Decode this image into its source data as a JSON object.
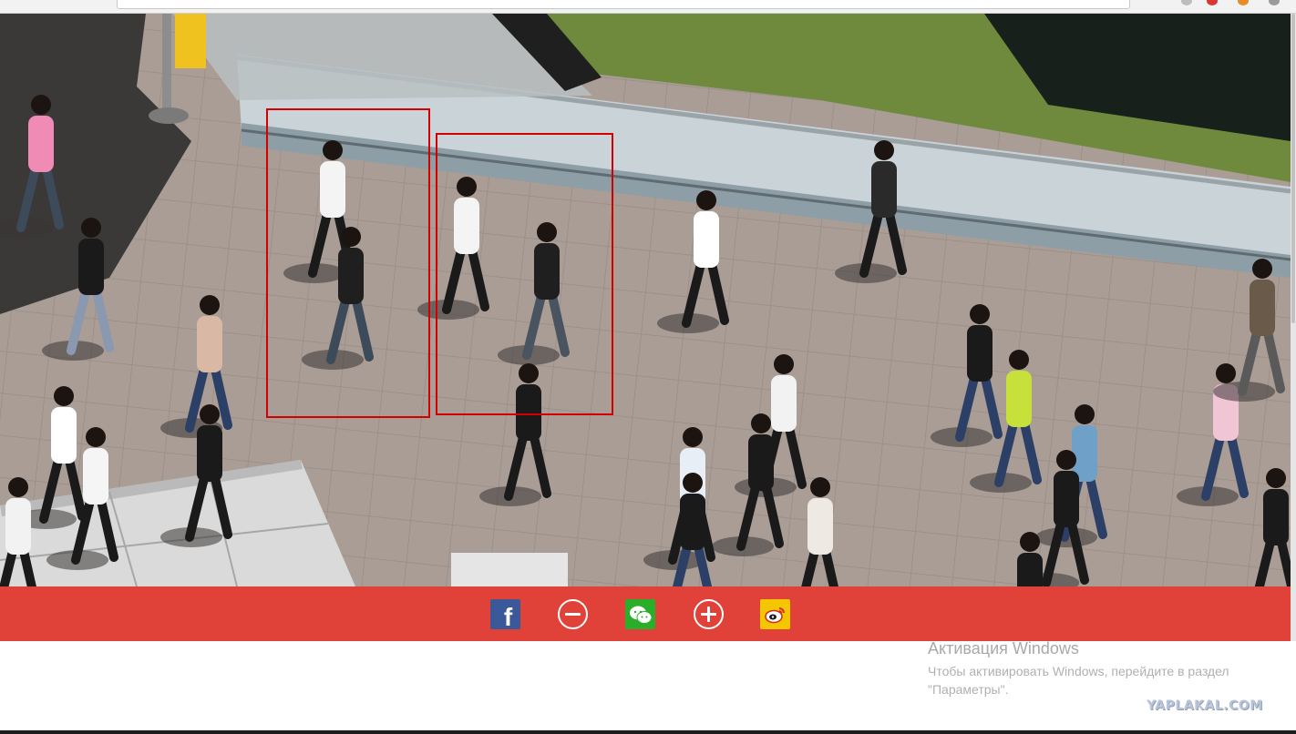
{
  "share_bar": {
    "buttons": [
      {
        "name": "facebook",
        "glyph": "f",
        "color": "#3b5998"
      },
      {
        "name": "zoom-out",
        "color": "#ffffff"
      },
      {
        "name": "wechat",
        "color": "#2aae2a"
      },
      {
        "name": "zoom-in",
        "color": "#ffffff"
      },
      {
        "name": "weibo",
        "color": "#f3c600"
      }
    ],
    "background": "#dc281e"
  },
  "photo": {
    "detection_box_color": "#d40000"
  },
  "activation": {
    "title": "Активация Windows",
    "text": "Чтобы активировать Windows, перейдите в раздел \"Параметры\"."
  },
  "watermark": "YAPLAKAL.COM"
}
